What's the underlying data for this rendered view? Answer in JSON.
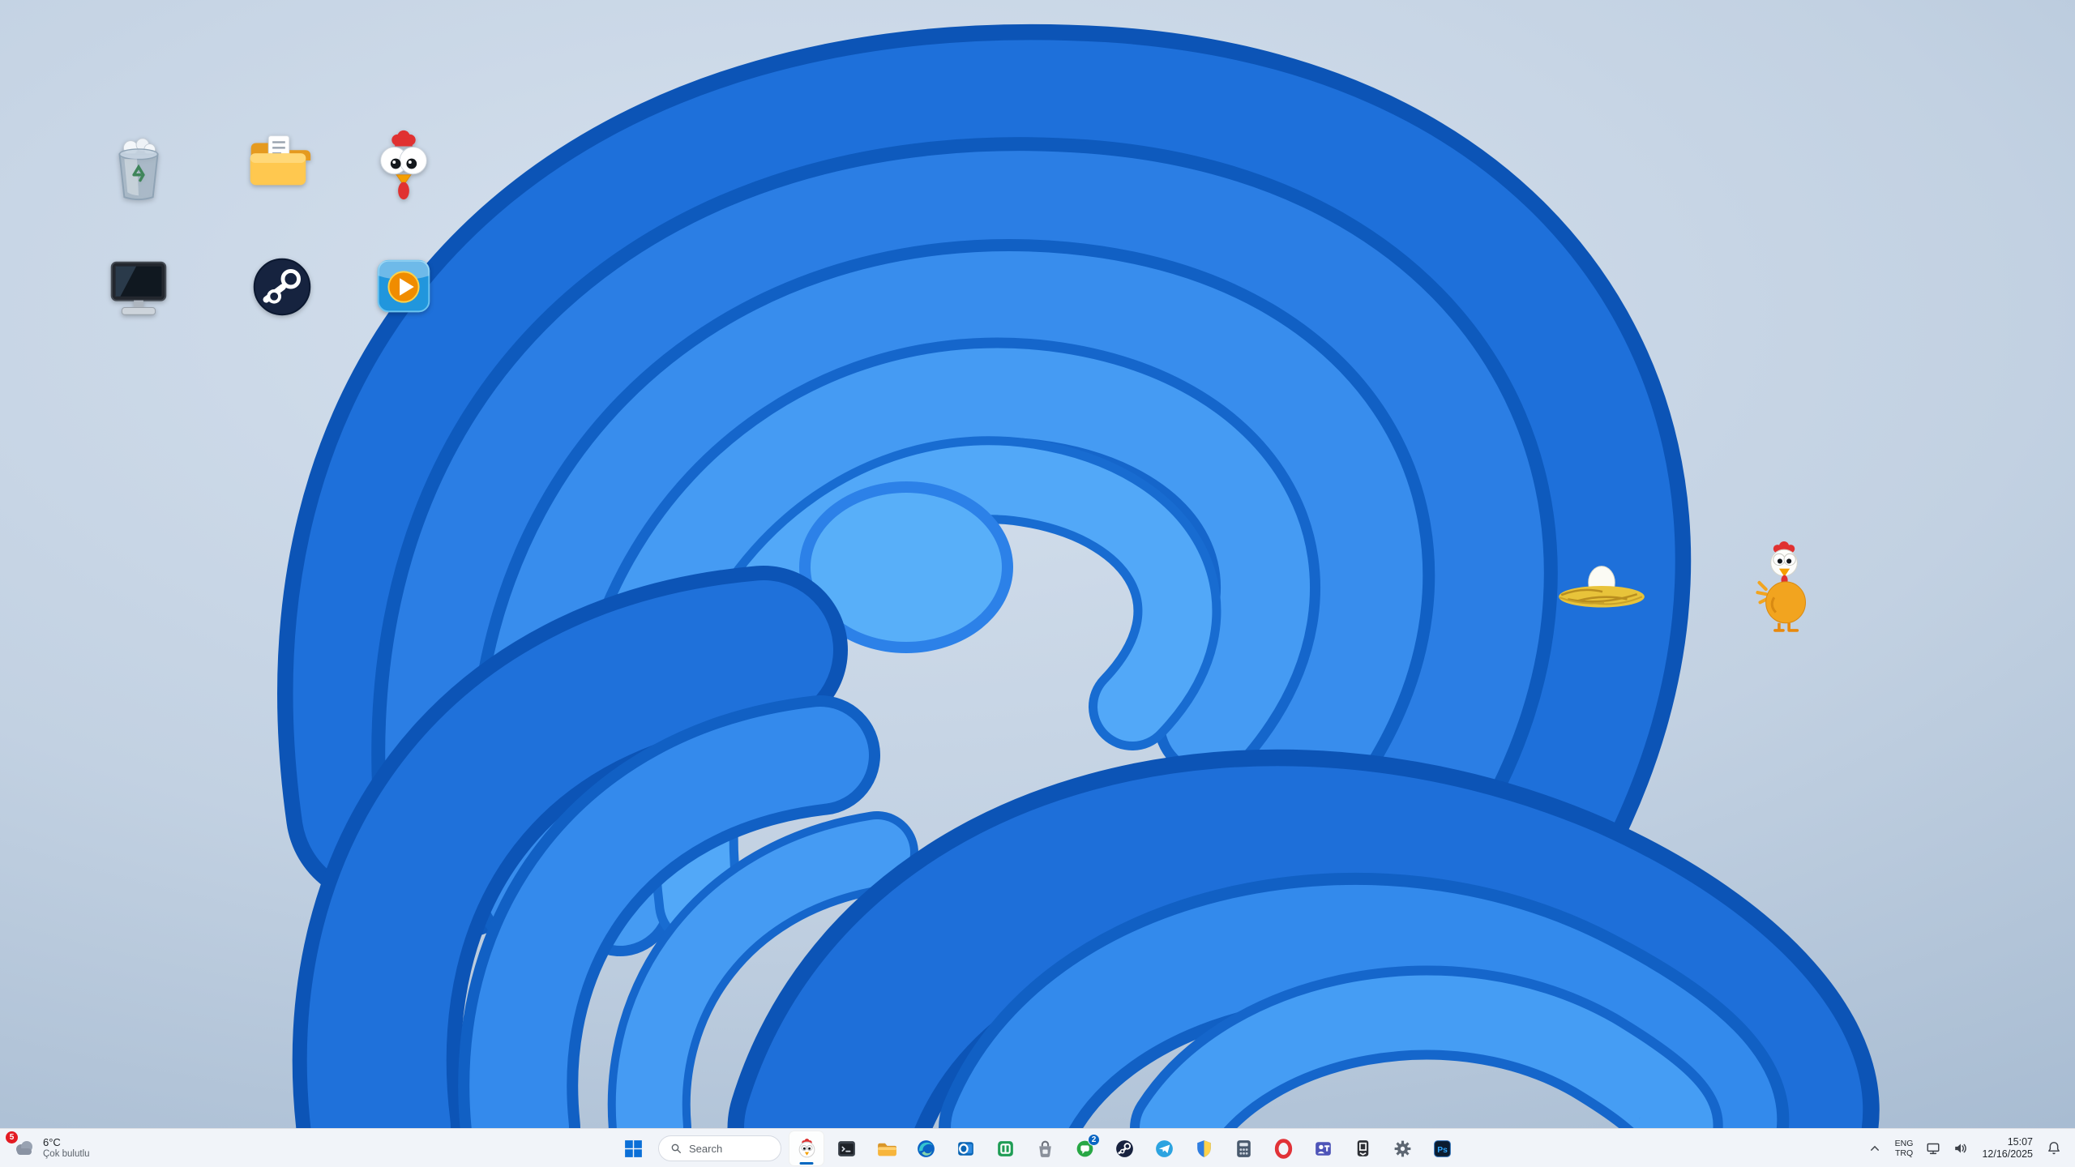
{
  "desktop": {
    "icons": [
      {
        "name": "recycle-bin"
      },
      {
        "name": "documents-folder"
      },
      {
        "name": "chicken-game"
      },
      {
        "name": "this-pc"
      },
      {
        "name": "steam"
      },
      {
        "name": "media-player"
      }
    ],
    "sprites": [
      {
        "name": "egg-nest"
      },
      {
        "name": "chicken-pet"
      }
    ],
    "wallpaper_accent": "#1e6fd9"
  },
  "taskbar": {
    "weather": {
      "badge": "5",
      "temperature": "6°C",
      "condition": "Çok bulutlu"
    },
    "search": {
      "placeholder": "Search"
    },
    "apps": [
      {
        "name": "chicken-invaders",
        "active": "true"
      },
      {
        "name": "terminal"
      },
      {
        "name": "file-explorer"
      },
      {
        "name": "edge"
      },
      {
        "name": "outlook"
      },
      {
        "name": "green-app"
      },
      {
        "name": "store"
      },
      {
        "name": "chat",
        "badge": "2"
      },
      {
        "name": "steam"
      },
      {
        "name": "telegram"
      },
      {
        "name": "windows-security"
      },
      {
        "name": "calculator"
      },
      {
        "name": "opera"
      },
      {
        "name": "teams"
      },
      {
        "name": "epic-games"
      },
      {
        "name": "settings"
      },
      {
        "name": "photoshop",
        "glyph": "Ps"
      }
    ],
    "tray": {
      "language_line1": "ENG",
      "language_line2": "TRQ",
      "time": "15:07",
      "date": "12/16/2025"
    }
  }
}
